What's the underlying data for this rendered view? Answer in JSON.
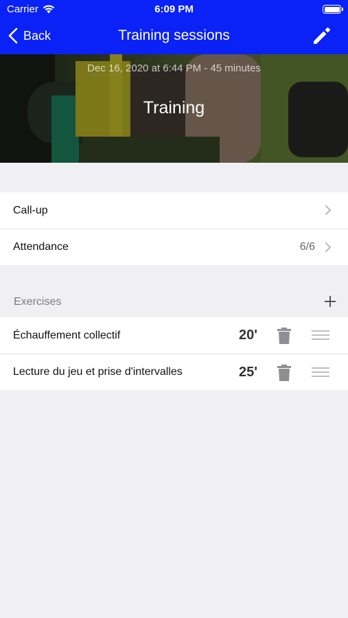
{
  "status_bar": {
    "carrier": "Carrier",
    "time": "6:09 PM"
  },
  "nav": {
    "back_label": "Back",
    "title": "Training sessions",
    "edit_icon": "pencil-icon"
  },
  "session": {
    "date_line": "Dec 16, 2020 at 6:44 PM - 45 minutes",
    "title": "Training"
  },
  "menu": {
    "callup_label": "Call-up",
    "attendance_label": "Attendance",
    "attendance_value": "6/6"
  },
  "exercises": {
    "header": "Exercises",
    "items": [
      {
        "name": "Échauffement collectif",
        "duration": "20'"
      },
      {
        "name": "Lecture du jeu et prise d'intervalles",
        "duration": "25'"
      }
    ]
  },
  "colors": {
    "nav_background": "#0a22f5",
    "page_background": "#efeff4",
    "icon_gray": "#8e8e93"
  }
}
